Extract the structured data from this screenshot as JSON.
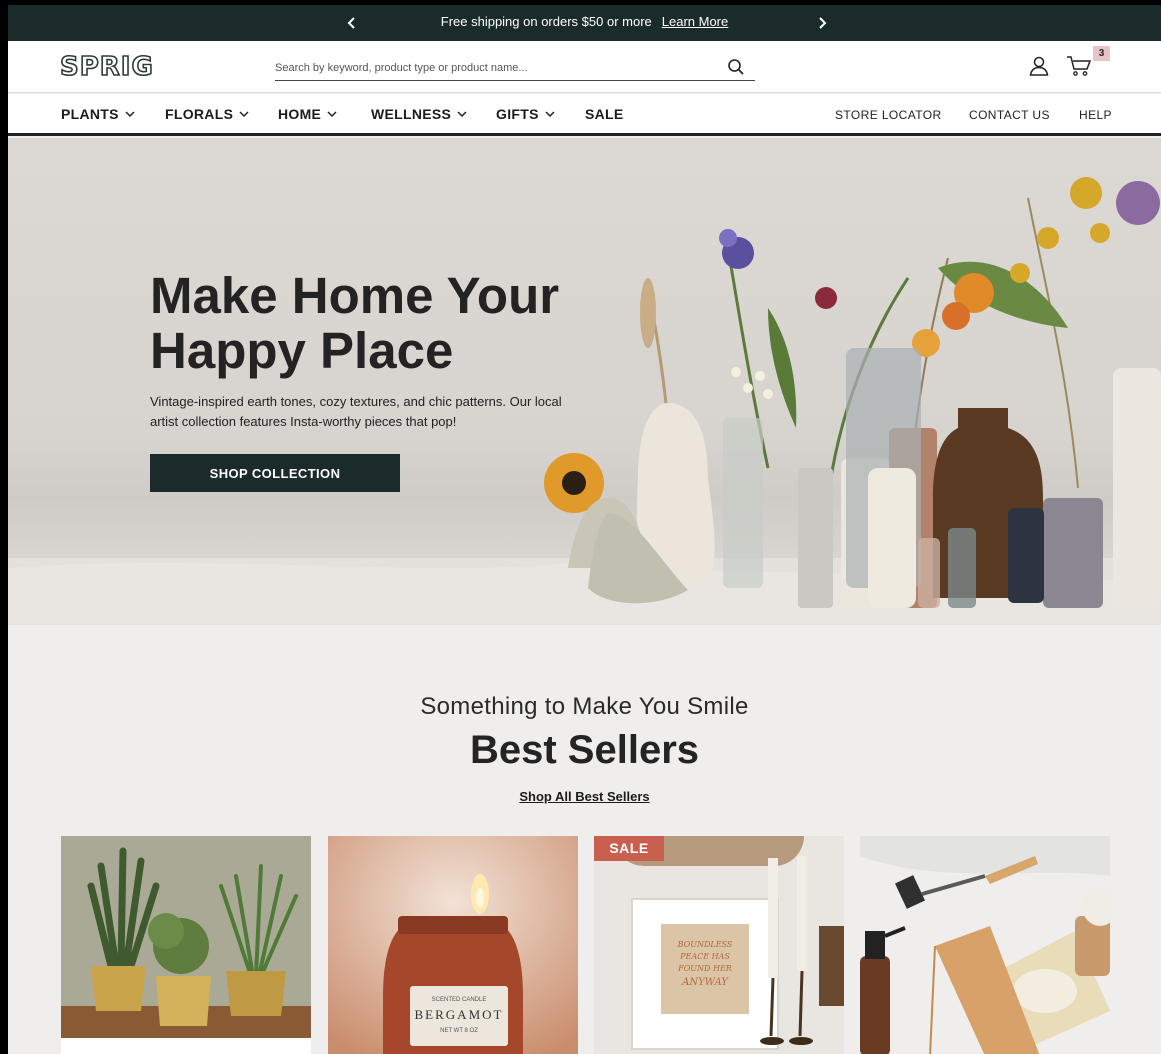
{
  "announcement": {
    "message": "Free shipping on orders $50 or more",
    "link": "Learn More",
    "prev_icon": "chevron-left-icon",
    "next_icon": "chevron-right-icon"
  },
  "header": {
    "logo": "SPRIG",
    "search_placeholder": "Search by keyword, product type or product name...",
    "cart_count": "3"
  },
  "nav": {
    "items": [
      {
        "label": "PLANTS"
      },
      {
        "label": "FLORALS"
      },
      {
        "label": "HOME"
      },
      {
        "label": "WELLNESS"
      },
      {
        "label": "GIFTS"
      },
      {
        "label": "SALE"
      }
    ],
    "utility": [
      "STORE LOCATOR",
      "CONTACT US",
      "HELP"
    ]
  },
  "hero": {
    "title_line1": "Make Home Your",
    "title_line2": "Happy Place",
    "description": "Vintage-inspired earth tones, cozy textures, and chic patterns. Our local artist collection features Insta-worthy pieces that pop!",
    "cta": "SHOP COLLECTION"
  },
  "best_sellers": {
    "subtitle": "Something to Make You Smile",
    "title": "Best Sellers",
    "link": "Shop All Best Sellers",
    "products": [
      {
        "image": "potted-plants"
      },
      {
        "image": "candle-jar",
        "label_line1": "SCENTED CANDLE",
        "label_line2": "BERGAMOT",
        "label_line3": "NET WT 8 OZ"
      },
      {
        "image": "framed-print",
        "badge": "SALE",
        "print_text": [
          "BOUNDLESS",
          "PEACE HAS",
          "FOUND HER",
          "ANYWAY"
        ]
      },
      {
        "image": "grooming-kit"
      }
    ]
  },
  "colors": {
    "dark_green": "#1b2b2b",
    "sale_badge": "#c9604f",
    "cart_badge": "#e8c4c8",
    "page_bg": "#efeeec"
  }
}
